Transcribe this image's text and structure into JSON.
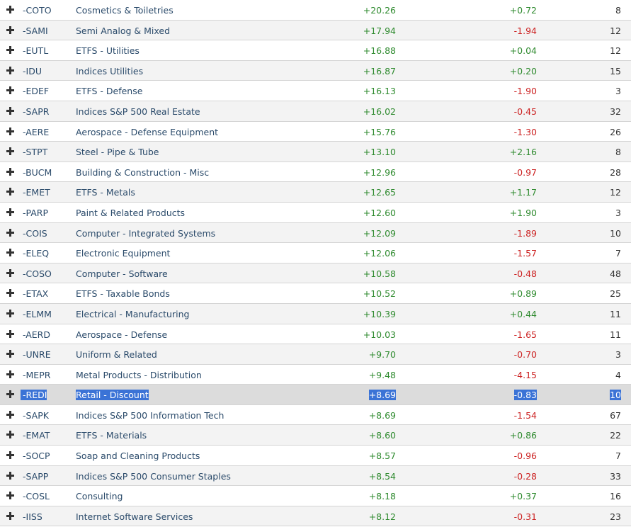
{
  "rows": [
    {
      "symbol": "-COTO",
      "name": "Cosmetics & Toiletries",
      "change1": "+20.26",
      "change2": "+0.72",
      "count": "8"
    },
    {
      "symbol": "-SAMI",
      "name": "Semi Analog & Mixed",
      "change1": "+17.94",
      "change2": "-1.94",
      "count": "12"
    },
    {
      "symbol": "-EUTL",
      "name": "ETFS - Utilities",
      "change1": "+16.88",
      "change2": "+0.04",
      "count": "12"
    },
    {
      "symbol": "-IDU",
      "name": "Indices Utilities",
      "change1": "+16.87",
      "change2": "+0.20",
      "count": "15"
    },
    {
      "symbol": "-EDEF",
      "name": "ETFS - Defense",
      "change1": "+16.13",
      "change2": "-1.90",
      "count": "3"
    },
    {
      "symbol": "-SAPR",
      "name": "Indices S&P 500 Real Estate",
      "change1": "+16.02",
      "change2": "-0.45",
      "count": "32"
    },
    {
      "symbol": "-AERE",
      "name": "Aerospace - Defense Equipment",
      "change1": "+15.76",
      "change2": "-1.30",
      "count": "26"
    },
    {
      "symbol": "-STPT",
      "name": "Steel - Pipe & Tube",
      "change1": "+13.10",
      "change2": "+2.16",
      "count": "8"
    },
    {
      "symbol": "-BUCM",
      "name": "Building & Construction - Misc",
      "change1": "+12.96",
      "change2": "-0.97",
      "count": "28"
    },
    {
      "symbol": "-EMET",
      "name": "ETFS - Metals",
      "change1": "+12.65",
      "change2": "+1.17",
      "count": "12"
    },
    {
      "symbol": "-PARP",
      "name": "Paint & Related Products",
      "change1": "+12.60",
      "change2": "+1.90",
      "count": "3"
    },
    {
      "symbol": "-COIS",
      "name": "Computer - Integrated Systems",
      "change1": "+12.09",
      "change2": "-1.89",
      "count": "10"
    },
    {
      "symbol": "-ELEQ",
      "name": "Electronic Equipment",
      "change1": "+12.06",
      "change2": "-1.57",
      "count": "7"
    },
    {
      "symbol": "-COSO",
      "name": "Computer - Software",
      "change1": "+10.58",
      "change2": "-0.48",
      "count": "48"
    },
    {
      "symbol": "-ETAX",
      "name": "ETFS - Taxable Bonds",
      "change1": "+10.52",
      "change2": "+0.89",
      "count": "25"
    },
    {
      "symbol": "-ELMM",
      "name": "Electrical - Manufacturing",
      "change1": "+10.39",
      "change2": "+0.44",
      "count": "11"
    },
    {
      "symbol": "-AERD",
      "name": "Aerospace - Defense",
      "change1": "+10.03",
      "change2": "-1.65",
      "count": "11"
    },
    {
      "symbol": "-UNRE",
      "name": "Uniform & Related",
      "change1": "+9.70",
      "change2": "-0.70",
      "count": "3"
    },
    {
      "symbol": "-MEPR",
      "name": "Metal Products - Distribution",
      "change1": "+9.48",
      "change2": "-4.15",
      "count": "4"
    },
    {
      "symbol": "-REDI",
      "name": "Retail - Discount",
      "change1": "+8.69",
      "change2": "-0.83",
      "count": "10"
    },
    {
      "symbol": "-SAPK",
      "name": "Indices S&P 500 Information Tech",
      "change1": "+8.69",
      "change2": "-1.54",
      "count": "67"
    },
    {
      "symbol": "-EMAT",
      "name": "ETFS - Materials",
      "change1": "+8.60",
      "change2": "+0.86",
      "count": "22"
    },
    {
      "symbol": "-SOCP",
      "name": "Soap and Cleaning Products",
      "change1": "+8.57",
      "change2": "-0.96",
      "count": "7"
    },
    {
      "symbol": "-SAPP",
      "name": "Indices S&P 500 Consumer Staples",
      "change1": "+8.54",
      "change2": "-0.28",
      "count": "33"
    },
    {
      "symbol": "-COSL",
      "name": "Consulting",
      "change1": "+8.18",
      "change2": "+0.37",
      "count": "16"
    },
    {
      "symbol": "-IISS",
      "name": "Internet Software Services",
      "change1": "+8.12",
      "change2": "-0.31",
      "count": "23"
    }
  ],
  "selected_symbol": "-REDI",
  "colors": {
    "positive": "#2e8a2e",
    "negative": "#cc2222",
    "selection": "#3b73d6",
    "selected_row": "#dcdcdc",
    "alt_row": "#f3f3f3"
  },
  "icons": {
    "expand": "plus-icon"
  }
}
